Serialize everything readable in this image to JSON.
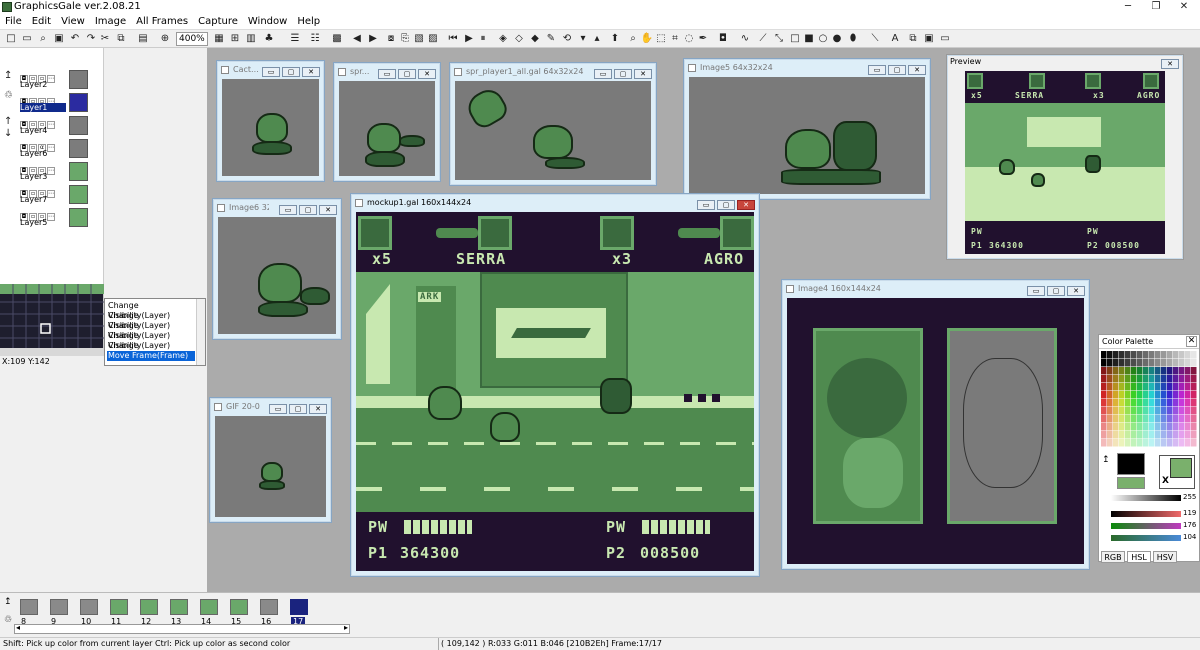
{
  "app": {
    "title": "GraphicsGale ver.2.08.21"
  },
  "window_controls": {
    "minimize": "─",
    "maximize": "❐",
    "close": "✕"
  },
  "menu": [
    "File",
    "Edit",
    "View",
    "Image",
    "All Frames",
    "Capture",
    "Window",
    "Help"
  ],
  "toolbar": {
    "zoom": "400%"
  },
  "layers": [
    {
      "name": "Layer2"
    },
    {
      "name": "Layer1",
      "selected": true
    },
    {
      "name": "Layer4"
    },
    {
      "name": "Layer6"
    },
    {
      "name": "Layer3"
    },
    {
      "name": "Layer7"
    },
    {
      "name": "Layer5"
    }
  ],
  "coords_left": "X:109 Y:142",
  "history": [
    "Change Visibility(Layer)",
    "Change Visibility(Layer)",
    "Change Visibility(Layer)",
    "Change Visibility(Layer)",
    "Change Visibility(Layer)",
    "Move Frame(Frame)"
  ],
  "windows": {
    "cact": {
      "title": "Cact..."
    },
    "spr": {
      "title": "spr..."
    },
    "spr_player": {
      "title": "spr_player1_all.gal 64x32x24"
    },
    "image5": {
      "title": "Image5 64x32x24"
    },
    "image6": {
      "title": "Image6 32..."
    },
    "gif": {
      "title": "GIF 20-0..."
    },
    "mockup": {
      "title": "mockup1.gal 160x144x24"
    },
    "image4": {
      "title": "Image4 160x144x24"
    },
    "preview": {
      "title": "Preview"
    }
  },
  "game_hud": {
    "lives_left": "x5",
    "name_left": "SERRA",
    "lives_right": "x3",
    "name_right": "AGRO",
    "pw_label": "PW",
    "p1_label": "P1",
    "p1_score": "364300",
    "p2_label": "P2",
    "p2_score": "008500",
    "sign": "ARK"
  },
  "color_palette": {
    "title": "Color Palette",
    "slider_values": [
      "255",
      "119",
      "176",
      "104"
    ],
    "tabs": [
      "RGB",
      "HSL",
      "HSV"
    ],
    "swap_label": "X",
    "selected_color": "#7ab06c"
  },
  "frames": [
    {
      "n": "8"
    },
    {
      "n": "9"
    },
    {
      "n": "10"
    },
    {
      "n": "11"
    },
    {
      "n": "12"
    },
    {
      "n": "13"
    },
    {
      "n": "14"
    },
    {
      "n": "15"
    },
    {
      "n": "16"
    },
    {
      "n": "17",
      "selected": true
    }
  ],
  "status": {
    "hint": "Shift: Pick up color from current layer  Ctrl: Pick up color as second color",
    "info": "( 109,142 ) R:033 G:011 B:046  [210B2Eh]  Frame:17/17"
  },
  "colors": {
    "workspace": "#ababab",
    "gb_dark": "#21112e",
    "gb_mid": "#4f8a4f",
    "gb_light": "#c8e8b0",
    "selection": "#102a8c"
  }
}
